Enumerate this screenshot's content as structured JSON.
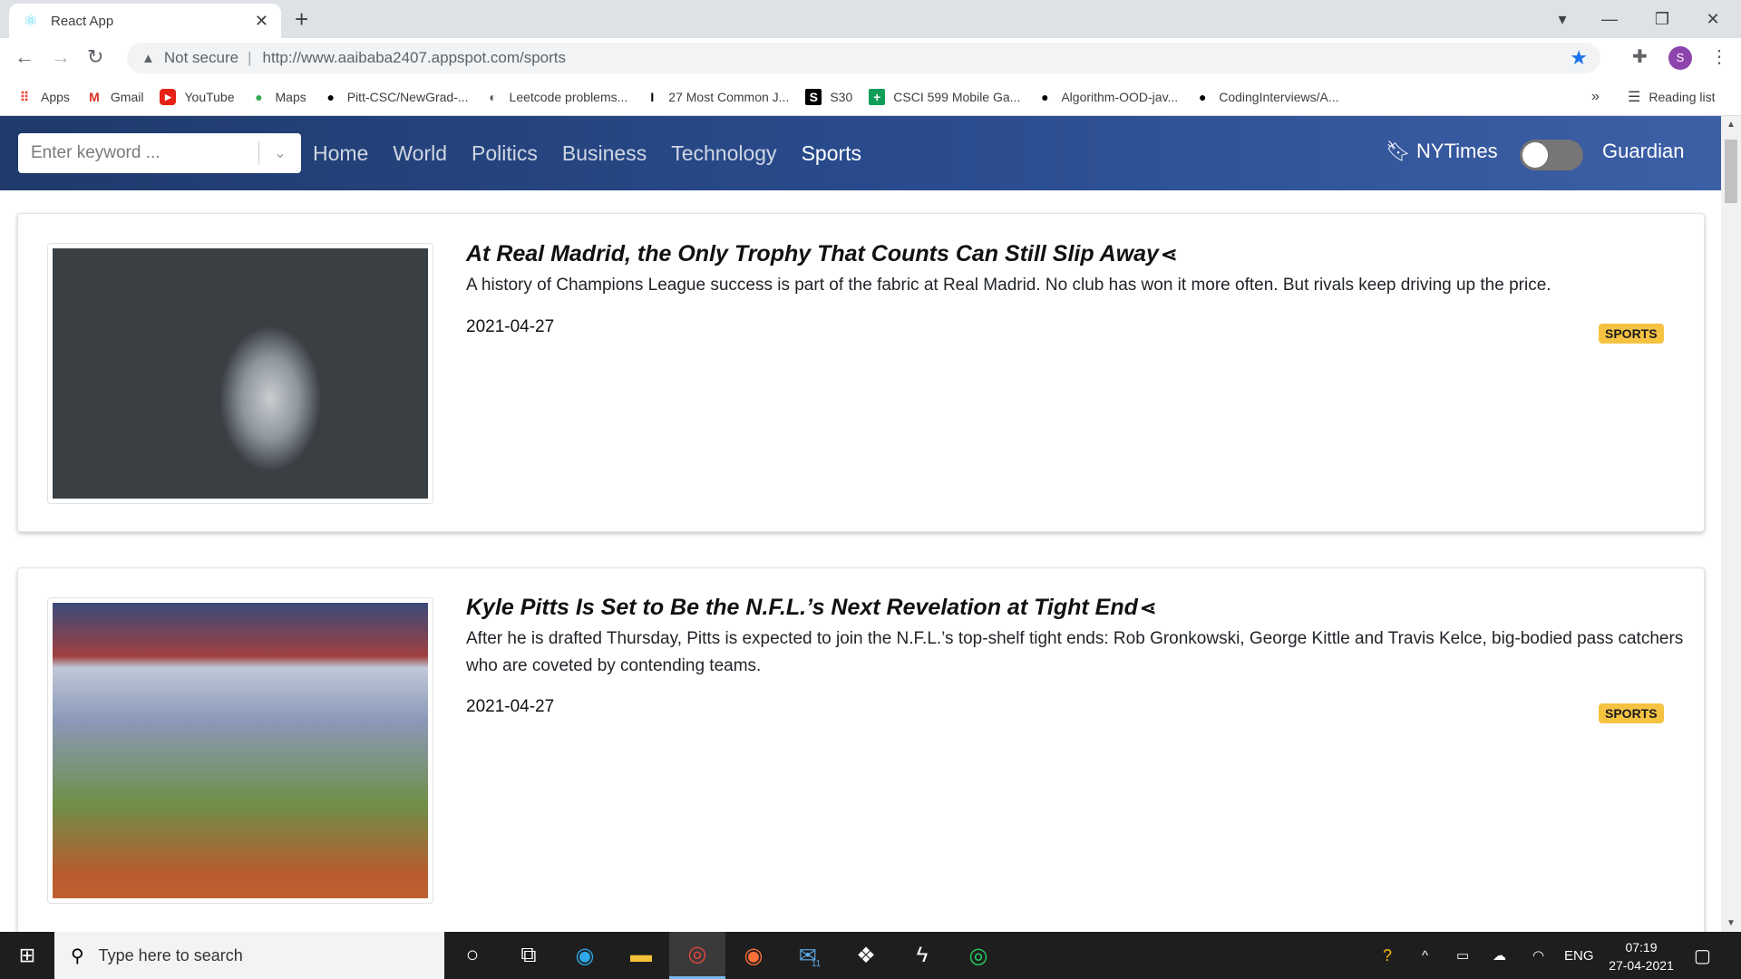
{
  "browser": {
    "tab_title": "React App",
    "security_label": "Not secure",
    "url": "http://www.aaibaba2407.appspot.com/sports",
    "profile_initial": "S",
    "bookmarks": [
      {
        "label": "Apps",
        "icon": "apps-grid-icon"
      },
      {
        "label": "Gmail",
        "icon": "gmail-icon"
      },
      {
        "label": "YouTube",
        "icon": "youtube-icon"
      },
      {
        "label": "Maps",
        "icon": "maps-icon"
      },
      {
        "label": "Pitt-CSC/NewGrad-...",
        "icon": "github-icon"
      },
      {
        "label": "Leetcode problems...",
        "icon": "globe-icon"
      },
      {
        "label": "27 Most Common J...",
        "icon": "cursor-icon"
      },
      {
        "label": "S30",
        "icon": "s30-icon"
      },
      {
        "label": "CSCI 599 Mobile Ga...",
        "icon": "sheets-icon"
      },
      {
        "label": "Algorithm-OOD-jav...",
        "icon": "github-icon"
      },
      {
        "label": "CodingInterviews/A...",
        "icon": "github-icon"
      }
    ],
    "more_bookmarks": "»",
    "reading_list": "Reading list"
  },
  "app": {
    "search_placeholder": "Enter keyword ...",
    "nav": [
      "Home",
      "World",
      "Politics",
      "Business",
      "Technology",
      "Sports"
    ],
    "active_section": "Sports",
    "source_left": "NYTimes",
    "source_right": "Guardian",
    "toggle_on": false
  },
  "articles": [
    {
      "title": "At Real Madrid, the Only Trophy That Counts Can Still Slip Away",
      "description": "A history of Champions League success is part of the fabric at Real Madrid. No club has won it more often. But rivals keep driving up the price.",
      "date": "2021-04-27",
      "section": "SPORTS"
    },
    {
      "title": "Kyle Pitts Is Set to Be the N.F.L.’s Next Revelation at Tight End",
      "description": "After he is drafted Thursday, Pitts is expected to join the N.F.L.’s top-shelf tight ends: Rob Gronkowski, George Kittle and Travis Kelce, big-bodied pass catchers who are coveted by contending teams.",
      "date": "2021-04-27",
      "section": "SPORTS"
    }
  ],
  "taskbar": {
    "search_placeholder": "Type here to search",
    "mail_badge": "11",
    "language": "ENG",
    "time": "07:19",
    "date": "27-04-2021"
  },
  "colors": {
    "nav_gradient_start": "#1f3a6b",
    "nav_gradient_end": "#3d5fa6",
    "badge": "#f5c242",
    "bookmark_star": "#1a73e8"
  }
}
